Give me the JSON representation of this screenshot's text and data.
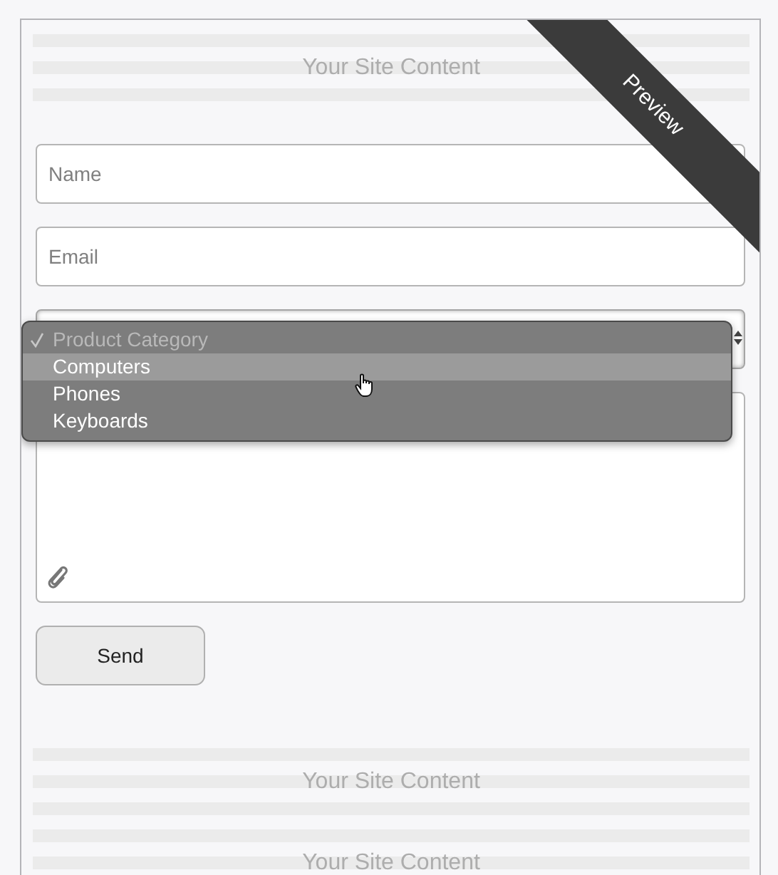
{
  "ribbon": {
    "label": "Preview"
  },
  "header_placeholder": {
    "label": "Your Site Content"
  },
  "form": {
    "fields": [
      {
        "kind": "input",
        "placeholder": "Name"
      },
      {
        "kind": "input",
        "placeholder": "Email"
      },
      {
        "kind": "select",
        "expanded": true,
        "options": [
          {
            "label": "Product Category",
            "selected": true,
            "disabled": true,
            "highlighted": false
          },
          {
            "label": "Computers",
            "selected": false,
            "disabled": false,
            "highlighted": true
          },
          {
            "label": "Phones",
            "selected": false,
            "disabled": false,
            "highlighted": false
          },
          {
            "label": "Keyboards",
            "selected": false,
            "disabled": false,
            "highlighted": false
          }
        ]
      },
      {
        "kind": "textarea"
      }
    ],
    "submit": "Send"
  },
  "footer_placeholders": [
    {
      "label": "Your Site Content"
    },
    {
      "label": "Your Site Content"
    }
  ]
}
